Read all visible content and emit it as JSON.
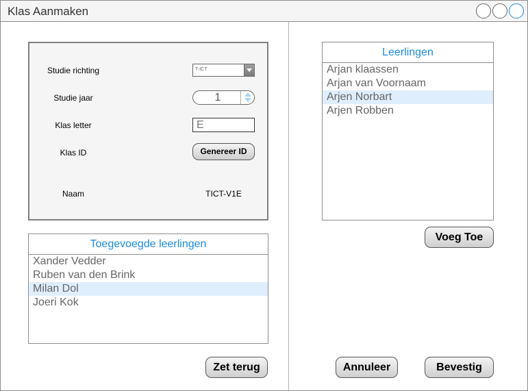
{
  "window": {
    "title": "Klas Aanmaken"
  },
  "form": {
    "studie_richting": {
      "label": "Studie richting",
      "value": "T-ICT"
    },
    "studie_jaar": {
      "label": "Studie jaar",
      "value": "1"
    },
    "klas_letter": {
      "label": "Klas letter",
      "value": "E"
    },
    "klas_id": {
      "label": "Klas ID",
      "button_label": "Genereer ID"
    },
    "naam": {
      "label": "Naam",
      "value": "TICT-V1E"
    }
  },
  "added_students": {
    "header": "Toegevoegde leerlingen",
    "items": [
      "Xander Vedder",
      "Ruben van den Brink",
      "Milan Dol",
      "Joeri Kok"
    ],
    "selected_index": 2,
    "reset_button": "Zet terug"
  },
  "students": {
    "header": "Leerlingen",
    "items": [
      "Arjan klaassen",
      "Arjan van Voornaam",
      "Arjen Norbart",
      "Arjen Robben"
    ],
    "selected_index": 2,
    "add_button": "Voeg Toe"
  },
  "footer": {
    "cancel_button": "Annuleer",
    "confirm_button": "Bevestig"
  },
  "colors": {
    "accent": "#1a8be0",
    "selection": "#dfeefc"
  }
}
